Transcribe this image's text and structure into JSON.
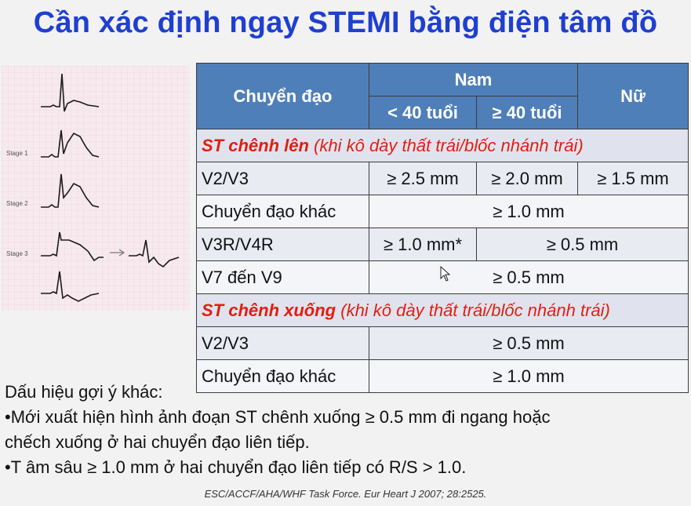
{
  "title": "Cần xác định ngay STEMI bằng điện tâm đồ",
  "ecg": {
    "stage_labels": [
      "Stage 1",
      "Stage 2",
      "Stage 3"
    ],
    "trace_color": "#1a1a1a",
    "grid_color": "#e8b9c6"
  },
  "table": {
    "header": {
      "lead": "Chuyển đạo",
      "male": "Nam",
      "male_under40": "< 40 tuổi",
      "male_over40": "≥ 40 tuổi",
      "female": "Nữ"
    },
    "elevation": {
      "title": "ST chênh lên",
      "note": " (khi kô dày thất trái/blốc nhánh trái)",
      "rows": [
        {
          "lead": "V2/V3",
          "a": "≥ 2.5 mm",
          "b": "≥ 2.0 mm",
          "c": "≥ 1.5 mm"
        },
        {
          "lead": "Chuyển đạo khác",
          "all": "≥ 1.0 mm"
        },
        {
          "lead": "V3R/V4R",
          "a": "≥ 1.0 mm*",
          "rest": "≥ 0.5 mm"
        },
        {
          "lead": "V7 đến V9",
          "all": "≥ 0.5 mm"
        }
      ]
    },
    "depression": {
      "title": "ST chênh xuống",
      "note": " (khi kô dày thất trái/blốc nhánh trái)",
      "rows": [
        {
          "lead": "V2/V3",
          "all": "≥ 0.5 mm"
        },
        {
          "lead": "Chuyển đạo khác",
          "all": "≥  1.0 mm"
        }
      ]
    }
  },
  "notes": {
    "heading": "Dấu hiệu gợi ý khác:",
    "bullet1_line1": "•Mới xuất hiện hình ảnh đoạn ST chênh xuống ≥ 0.5 mm đi ngang hoặc",
    "bullet1_line2": "chếch xuống ở hai chuyển đạo liên tiếp.",
    "bullet2": "•T âm sâu ≥ 1.0 mm ở hai chuyển đạo liên tiếp có R/S > 1.0."
  },
  "citation": "ESC/ACCF/AHA/WHF Task Force. Eur Heart J 2007; 28:2525.",
  "colors": {
    "title": "#1f3fd0",
    "header_bg": "#4f7fb8",
    "section_red": "#e01f10"
  }
}
